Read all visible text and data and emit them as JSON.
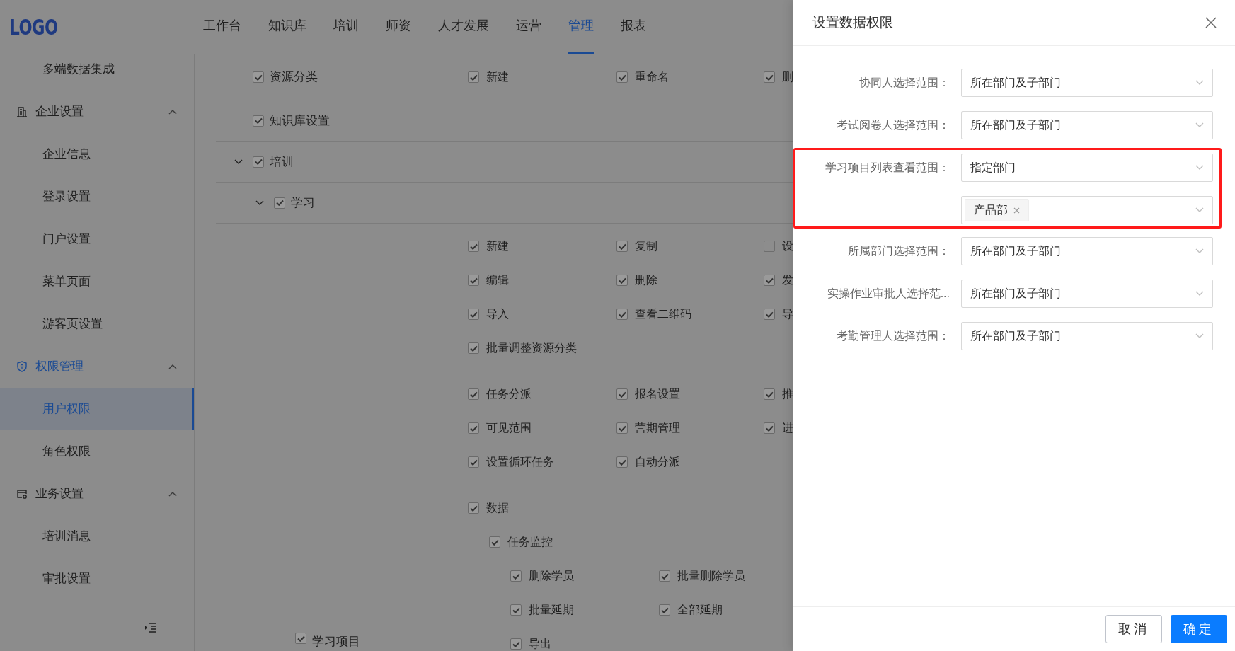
{
  "header": {
    "logo": "LOGO",
    "nav": [
      {
        "label": "工作台",
        "selected": false
      },
      {
        "label": "知识库",
        "selected": false
      },
      {
        "label": "培训",
        "selected": false
      },
      {
        "label": "师资",
        "selected": false
      },
      {
        "label": "人才发展",
        "selected": false
      },
      {
        "label": "运营",
        "selected": false
      },
      {
        "label": "管理",
        "selected": true
      },
      {
        "label": "报表",
        "selected": false
      }
    ]
  },
  "sidebar": {
    "items": [
      {
        "kind": "item",
        "label": "多端数据集成",
        "selected": false
      },
      {
        "kind": "group",
        "label": "企业设置",
        "expanded": true,
        "active": false,
        "children": [
          {
            "kind": "item",
            "label": "企业信息",
            "selected": false
          },
          {
            "kind": "item",
            "label": "登录设置",
            "selected": false
          },
          {
            "kind": "item",
            "label": "门户设置",
            "selected": false
          },
          {
            "kind": "item",
            "label": "菜单页面",
            "selected": false
          },
          {
            "kind": "item",
            "label": "游客页设置",
            "selected": false
          }
        ]
      },
      {
        "kind": "group",
        "label": "权限管理",
        "expanded": true,
        "active": true,
        "children": [
          {
            "kind": "item",
            "label": "用户权限",
            "selected": true
          },
          {
            "kind": "item",
            "label": "角色权限",
            "selected": false
          }
        ]
      },
      {
        "kind": "group",
        "label": "业务设置",
        "expanded": true,
        "active": false,
        "children": [
          {
            "kind": "item",
            "label": "培训消息",
            "selected": false
          },
          {
            "kind": "item",
            "label": "审批设置",
            "selected": false
          }
        ]
      }
    ]
  },
  "tree": [
    {
      "label": "资源分类",
      "checked": true,
      "permission_groups": [
        {
          "items": [
            {
              "label": "新建",
              "checked": true
            },
            {
              "label": "重命名",
              "checked": true
            },
            {
              "label": "删",
              "checked": true
            }
          ]
        }
      ]
    },
    {
      "label": "知识库设置",
      "checked": true
    },
    {
      "label": "培训",
      "checked": true,
      "expanded": true,
      "children": [
        {
          "label": "学习",
          "checked": true,
          "expanded": true,
          "children": [
            {
              "label": "学习项目",
              "checked": true,
              "permission_groups": [
                {
                  "items": [
                    {
                      "label": "新建",
                      "checked": true
                    },
                    {
                      "label": "复制",
                      "checked": true
                    },
                    {
                      "label": "设",
                      "checked": false
                    },
                    {
                      "label": "编辑",
                      "checked": true
                    },
                    {
                      "label": "删除",
                      "checked": true
                    },
                    {
                      "label": "发",
                      "checked": true
                    },
                    {
                      "label": "导入",
                      "checked": true
                    },
                    {
                      "label": "查看二维码",
                      "checked": true
                    },
                    {
                      "label": "导",
                      "checked": true
                    },
                    {
                      "label": "批量调整资源分类",
                      "checked": true
                    }
                  ]
                },
                {
                  "items": [
                    {
                      "label": "任务分派",
                      "checked": true
                    },
                    {
                      "label": "报名设置",
                      "checked": true
                    },
                    {
                      "label": "推",
                      "checked": true
                    },
                    {
                      "label": "可见范围",
                      "checked": true
                    },
                    {
                      "label": "营期管理",
                      "checked": true
                    },
                    {
                      "label": "进",
                      "checked": true
                    },
                    {
                      "label": "设置循环任务",
                      "checked": true
                    },
                    {
                      "label": "自动分派",
                      "checked": true
                    }
                  ]
                },
                {
                  "items": [
                    {
                      "label": "数据",
                      "checked": true,
                      "children": [
                        {
                          "label": "任务监控",
                          "checked": true,
                          "children": [
                            {
                              "label": "删除学员",
                              "checked": true
                            },
                            {
                              "label": "批量删除学员",
                              "checked": true
                            },
                            {
                              "label": "批量延期",
                              "checked": true
                            },
                            {
                              "label": "全部延期",
                              "checked": true
                            },
                            {
                              "label": "导出",
                              "checked": true
                            }
                          ]
                        }
                      ]
                    }
                  ]
                }
              ]
            }
          ]
        }
      ]
    }
  ],
  "drawer": {
    "title": "设置数据权限",
    "fields": [
      {
        "label": "协同人选择范围：",
        "value": "所在部门及子部门",
        "highlighted": false
      },
      {
        "label": "考试阅卷人选择范围：",
        "value": "所在部门及子部门",
        "highlighted": false
      },
      {
        "label": "学习项目列表查看范围：",
        "value": "指定部门",
        "highlighted": true,
        "tags": [
          "产品部"
        ]
      },
      {
        "label": "所属部门选择范围：",
        "value": "所在部门及子部门",
        "highlighted": false
      },
      {
        "label": "实操作业审批人选择范...",
        "value": "所在部门及子部门",
        "highlighted": false
      },
      {
        "label": "考勤管理人选择范围：",
        "value": "所在部门及子部门",
        "highlighted": false
      }
    ],
    "buttons": [
      {
        "label": "取消",
        "kind": "default"
      },
      {
        "label": "确定",
        "kind": "primary"
      }
    ]
  }
}
